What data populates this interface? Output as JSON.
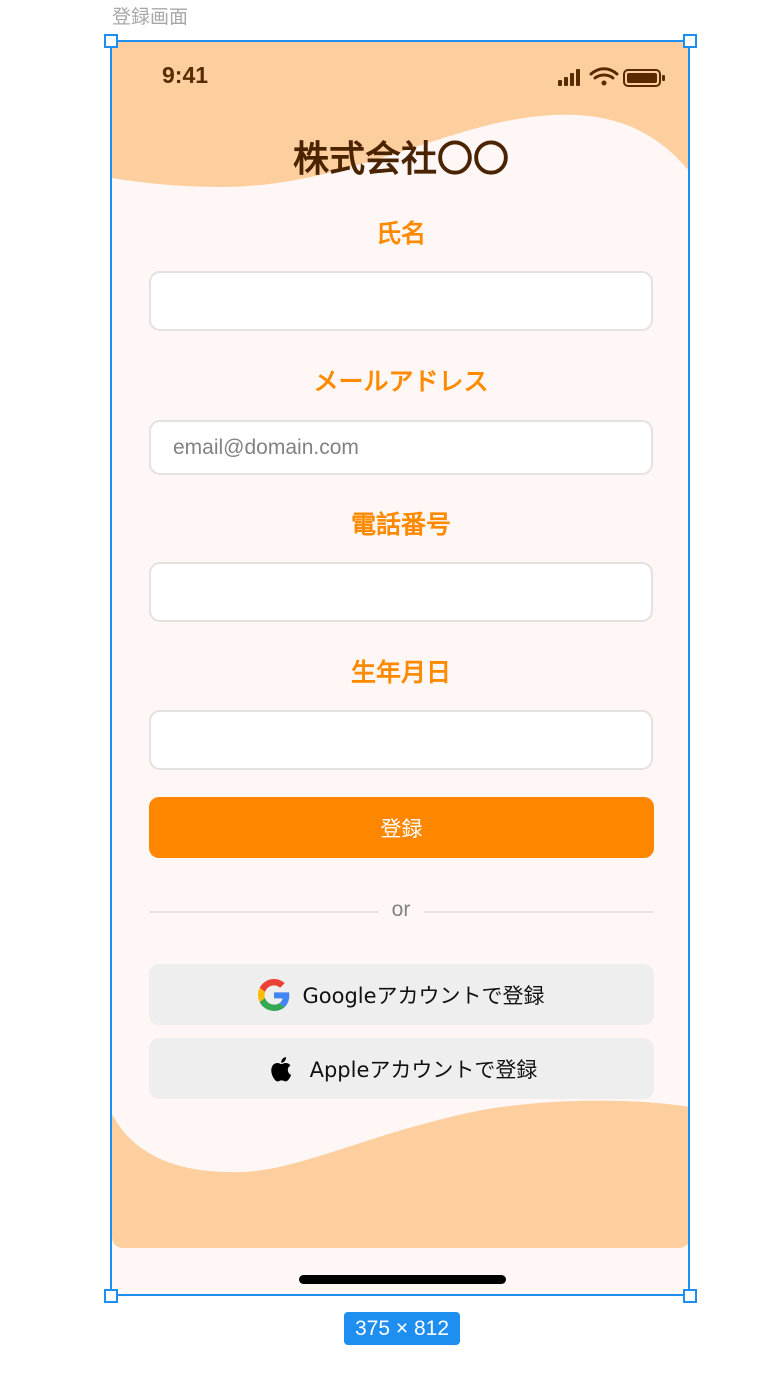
{
  "frame": {
    "label": "登録画面",
    "size_badge": "375 × 812"
  },
  "status_bar": {
    "time": "9:41",
    "icons": [
      "cellular-signal-icon",
      "wifi-icon",
      "battery-icon"
    ]
  },
  "header": {
    "company_name": "株式会社〇〇"
  },
  "form": {
    "name": {
      "label": "氏名",
      "value": "",
      "placeholder": ""
    },
    "email": {
      "label": "メールアドレス",
      "value": "",
      "placeholder": "email@domain.com"
    },
    "phone": {
      "label": "電話番号",
      "value": "",
      "placeholder": ""
    },
    "birthdate": {
      "label": "生年月日",
      "value": "",
      "placeholder": ""
    },
    "submit_label": "登録"
  },
  "divider": {
    "text": "or"
  },
  "social": {
    "google_label": "Googleアカウントで登録",
    "google_icon": "google-icon",
    "apple_label": "Appleアカウントで登録",
    "apple_icon": "apple-icon"
  },
  "colors": {
    "accent": "#FF8700",
    "label": "#FF8A00",
    "wave": "#FECF9E",
    "background": "#FFF7F6",
    "title": "#4A2300",
    "selection": "#1E8EF0"
  }
}
